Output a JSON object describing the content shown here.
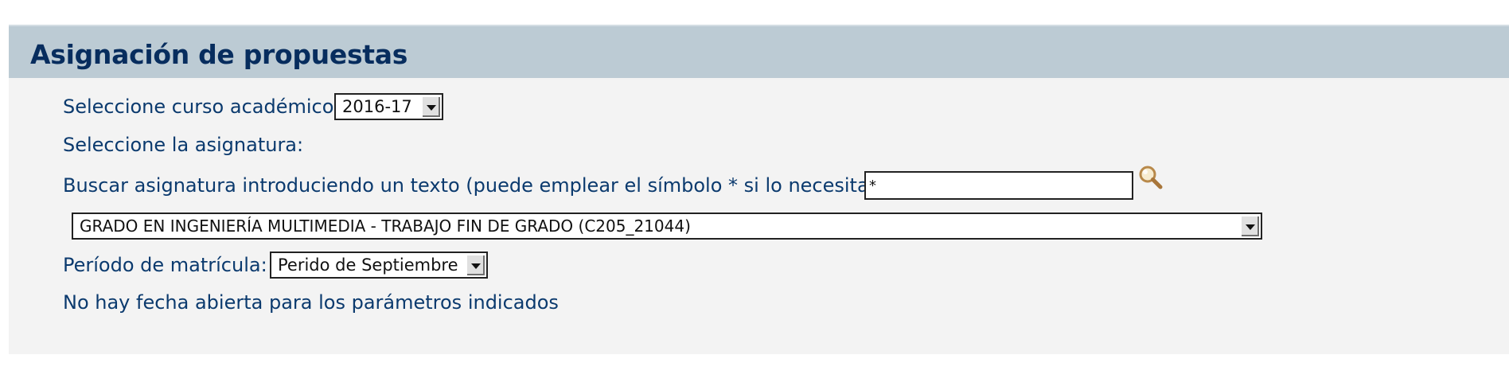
{
  "header": {
    "title": "Asignación de propuestas"
  },
  "academic_year": {
    "label": "Seleccione curso académico:",
    "selected": "2016-17"
  },
  "subject": {
    "label": "Seleccione la asignatura:",
    "search_label": "Buscar asignatura introduciendo un texto (puede emplear el símbolo * si lo necesitara):",
    "search_value": "*",
    "selected": "GRADO EN INGENIERÍA MULTIMEDIA - TRABAJO FIN DE GRADO (C205_21044)"
  },
  "enrollment_period": {
    "label": "Período de matrícula:",
    "selected": "Perido de Septiembre"
  },
  "status_message": "No hay fecha abierta para los parámetros indicados",
  "icons": {
    "search": "magnifier-icon",
    "dropdown": "chevron-down-icon"
  },
  "colors": {
    "header_bg": "#bccbd4",
    "title": "#072d5e",
    "text": "#0b3a6e",
    "panel_bg": "#f3f3f3"
  }
}
